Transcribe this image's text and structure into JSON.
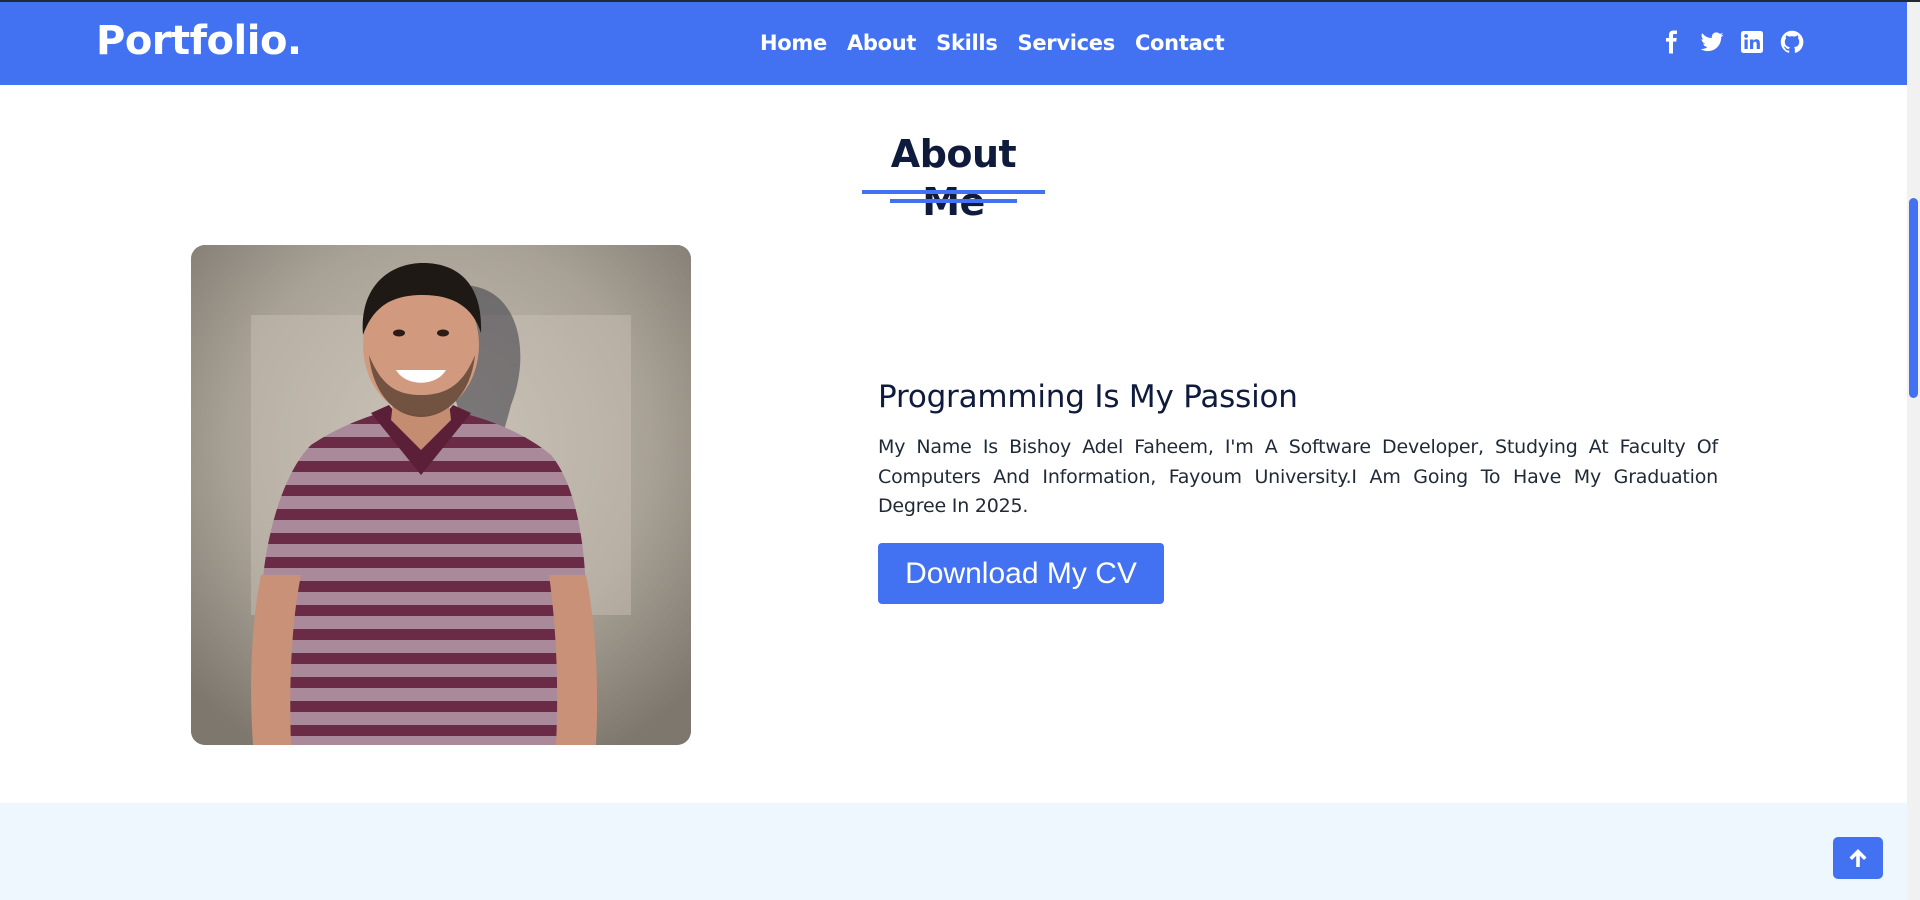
{
  "navbar": {
    "brand": "Portfolio.",
    "links": [
      {
        "label": "Home"
      },
      {
        "label": "About"
      },
      {
        "label": "Skills"
      },
      {
        "label": "Services"
      },
      {
        "label": "Contact"
      }
    ],
    "social": [
      {
        "icon": "facebook-icon"
      },
      {
        "icon": "twitter-icon"
      },
      {
        "icon": "linkedin-icon"
      },
      {
        "icon": "github-icon"
      }
    ]
  },
  "about": {
    "title": "About Me",
    "photo": {
      "icon": "profile-photo"
    },
    "heading": "Programming Is My Passion",
    "text": "My Name Is Bishoy Adel Faheem, I'm A Software Developer, Studying At Faculty Of Computers And Information, Fayoum University.I Am Going To Have My Graduation Degree In 2025.",
    "cv_button": "Download My CV"
  },
  "scroll_to_top": {
    "icon": "arrow-up-icon"
  },
  "colors": {
    "accent": "#4272f1",
    "heading": "#0f1b3d",
    "section_alt_bg": "#eef6fe"
  }
}
